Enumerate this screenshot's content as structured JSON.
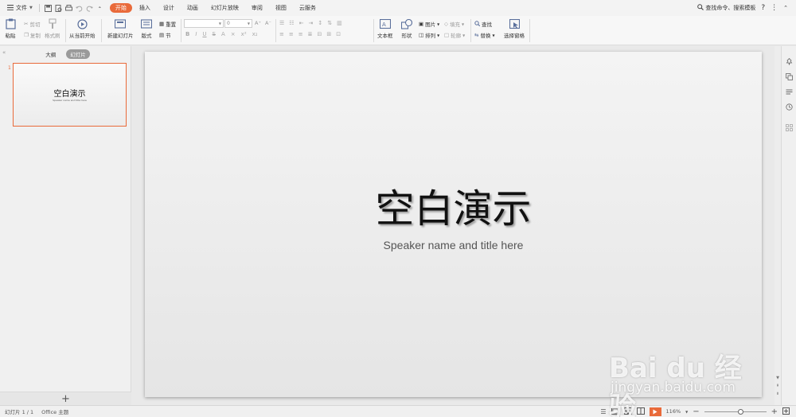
{
  "menubar": {
    "file_label": "文件",
    "tabs": [
      {
        "label": "开始",
        "active": true
      },
      {
        "label": "插入",
        "active": false
      },
      {
        "label": "设计",
        "active": false
      },
      {
        "label": "动画",
        "active": false
      },
      {
        "label": "幻灯片放映",
        "active": false
      },
      {
        "label": "审阅",
        "active": false
      },
      {
        "label": "视图",
        "active": false
      },
      {
        "label": "云服务",
        "active": false
      }
    ],
    "search_label": "查找命令、搜索模板",
    "help_label": "?"
  },
  "ribbon": {
    "paste": "粘贴",
    "cut": "剪切",
    "copy": "复制",
    "format_painter": "格式刷",
    "from_current": "从当前开始",
    "new_slide": "新建幻灯片",
    "layout": "版式",
    "reset": "重置",
    "section": "节",
    "font_size_value": "0",
    "bold": "B",
    "italic": "I",
    "underline": "U",
    "strike": "S",
    "font_color": "A",
    "grow_font": "A⁺",
    "shrink_font": "A⁻",
    "textbox": "文本框",
    "shape": "形状",
    "picture": "图片",
    "arrange": "排列",
    "fill": "填充",
    "outline": "轮廓",
    "find": "查找",
    "replace": "替换",
    "select_pane": "选择窗格"
  },
  "leftpanel": {
    "tab_outline": "大纲",
    "tab_slides": "幻灯片",
    "thumb_number": "1",
    "thumb_title": "空白演示",
    "thumb_subtitle": "Speaker name and title here",
    "add_slide": "+"
  },
  "slide": {
    "title": "空白演示",
    "subtitle": "Speaker name and title here"
  },
  "statusbar": {
    "slide_count": "幻灯片 1 / 1",
    "theme": "Office 主题",
    "zoom": "116%",
    "zoom_fraction": 0.6
  },
  "watermark": {
    "brand": "Bai du 经验",
    "url": "jingyan.baidu.com"
  },
  "colors": {
    "accent": "#e96a3a",
    "ribbon_bg": "#f7f7f7",
    "canvas_bg": "#e9e9e9"
  }
}
